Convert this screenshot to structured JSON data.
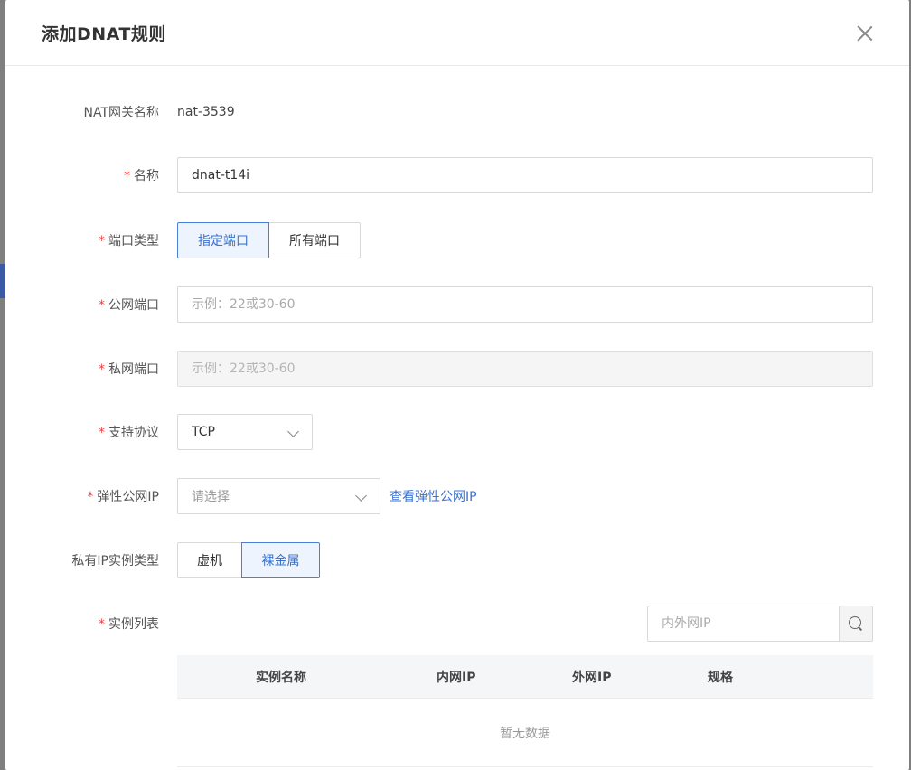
{
  "dialog": {
    "title": "添加DNAT规则"
  },
  "form": {
    "nat_gateway": {
      "label": "NAT网关名称",
      "value": "nat-3539"
    },
    "name": {
      "label": "名称",
      "value": "dnat-t14i"
    },
    "port_type": {
      "label": "端口类型",
      "options": [
        "指定端口",
        "所有端口"
      ],
      "selected": "指定端口"
    },
    "public_port": {
      "label": "公网端口",
      "placeholder": "示例：22或30-60"
    },
    "private_port": {
      "label": "私网端口",
      "placeholder": "示例：22或30-60"
    },
    "protocol": {
      "label": "支持协议",
      "value": "TCP"
    },
    "eip": {
      "label": "弹性公网IP",
      "placeholder": "请选择",
      "link": "查看弹性公网IP"
    },
    "instance_type": {
      "label": "私有IP实例类型",
      "options": [
        "虚机",
        "裸金属"
      ],
      "selected": "裸金属"
    },
    "instance_list": {
      "label": "实例列表",
      "search_placeholder": "内外网IP",
      "columns": [
        "实例名称",
        "内网IP",
        "外网IP",
        "规格"
      ],
      "empty_text": "暂无数据"
    }
  },
  "required_mark": "*"
}
